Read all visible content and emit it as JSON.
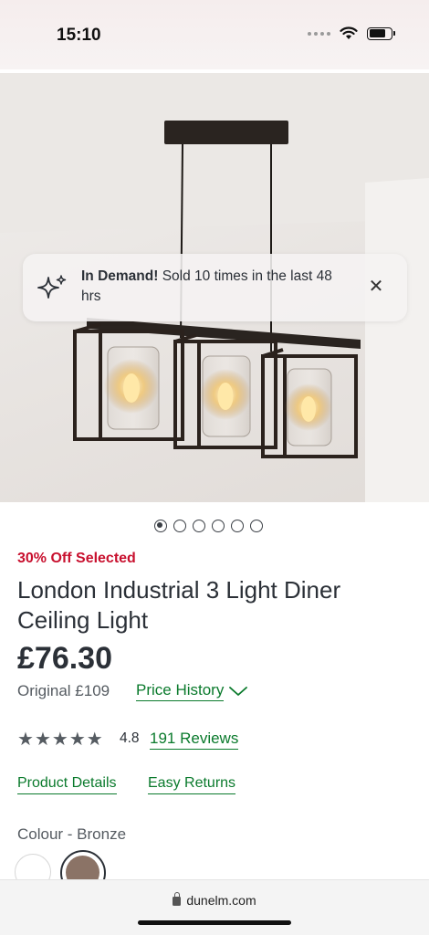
{
  "status_bar": {
    "time": "15:10"
  },
  "toast": {
    "heading": "In Demand!",
    "message": "Sold 10 times in the last 48 hrs",
    "close_icon": "close-icon",
    "sparkle_icon": "sparkle-icon"
  },
  "carousel": {
    "total": 6,
    "active": 1
  },
  "product": {
    "promo": "30% Off Selected",
    "title": "London Industrial 3 Light Diner Ceiling Light",
    "price": "£76.30",
    "original_price": "Original £109",
    "price_history_label": "Price History",
    "rating": "4.8",
    "star_count": 5,
    "reviews_label": "191 Reviews",
    "tabs": [
      "Product Details",
      "Easy Returns"
    ],
    "colour_label": "Colour - Bronze",
    "swatches": [
      {
        "name": "white",
        "color": "#ffffff",
        "selected": false
      },
      {
        "name": "bronze",
        "color": "#8b7366",
        "selected": true
      }
    ]
  },
  "browser": {
    "url": "dunelm.com"
  },
  "colors": {
    "accent_green": "#0a7a2c",
    "promo_red": "#c8102e",
    "text": "#2b3037"
  }
}
